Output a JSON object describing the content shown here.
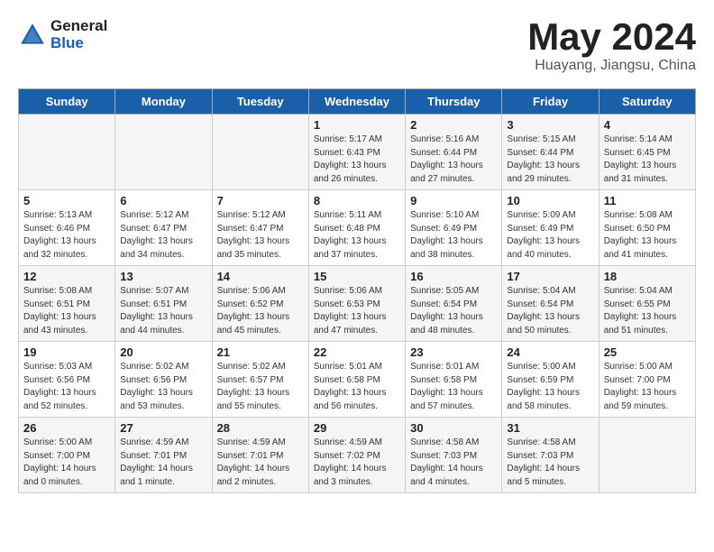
{
  "logo": {
    "general": "General",
    "blue": "Blue"
  },
  "title": "May 2024",
  "location": "Huayang, Jiangsu, China",
  "days_header": [
    "Sunday",
    "Monday",
    "Tuesday",
    "Wednesday",
    "Thursday",
    "Friday",
    "Saturday"
  ],
  "weeks": [
    [
      {
        "day": "",
        "info": ""
      },
      {
        "day": "",
        "info": ""
      },
      {
        "day": "",
        "info": ""
      },
      {
        "day": "1",
        "info": "Sunrise: 5:17 AM\nSunset: 6:43 PM\nDaylight: 13 hours\nand 26 minutes."
      },
      {
        "day": "2",
        "info": "Sunrise: 5:16 AM\nSunset: 6:44 PM\nDaylight: 13 hours\nand 27 minutes."
      },
      {
        "day": "3",
        "info": "Sunrise: 5:15 AM\nSunset: 6:44 PM\nDaylight: 13 hours\nand 29 minutes."
      },
      {
        "day": "4",
        "info": "Sunrise: 5:14 AM\nSunset: 6:45 PM\nDaylight: 13 hours\nand 31 minutes."
      }
    ],
    [
      {
        "day": "5",
        "info": "Sunrise: 5:13 AM\nSunset: 6:46 PM\nDaylight: 13 hours\nand 32 minutes."
      },
      {
        "day": "6",
        "info": "Sunrise: 5:12 AM\nSunset: 6:47 PM\nDaylight: 13 hours\nand 34 minutes."
      },
      {
        "day": "7",
        "info": "Sunrise: 5:12 AM\nSunset: 6:47 PM\nDaylight: 13 hours\nand 35 minutes."
      },
      {
        "day": "8",
        "info": "Sunrise: 5:11 AM\nSunset: 6:48 PM\nDaylight: 13 hours\nand 37 minutes."
      },
      {
        "day": "9",
        "info": "Sunrise: 5:10 AM\nSunset: 6:49 PM\nDaylight: 13 hours\nand 38 minutes."
      },
      {
        "day": "10",
        "info": "Sunrise: 5:09 AM\nSunset: 6:49 PM\nDaylight: 13 hours\nand 40 minutes."
      },
      {
        "day": "11",
        "info": "Sunrise: 5:08 AM\nSunset: 6:50 PM\nDaylight: 13 hours\nand 41 minutes."
      }
    ],
    [
      {
        "day": "12",
        "info": "Sunrise: 5:08 AM\nSunset: 6:51 PM\nDaylight: 13 hours\nand 43 minutes."
      },
      {
        "day": "13",
        "info": "Sunrise: 5:07 AM\nSunset: 6:51 PM\nDaylight: 13 hours\nand 44 minutes."
      },
      {
        "day": "14",
        "info": "Sunrise: 5:06 AM\nSunset: 6:52 PM\nDaylight: 13 hours\nand 45 minutes."
      },
      {
        "day": "15",
        "info": "Sunrise: 5:06 AM\nSunset: 6:53 PM\nDaylight: 13 hours\nand 47 minutes."
      },
      {
        "day": "16",
        "info": "Sunrise: 5:05 AM\nSunset: 6:54 PM\nDaylight: 13 hours\nand 48 minutes."
      },
      {
        "day": "17",
        "info": "Sunrise: 5:04 AM\nSunset: 6:54 PM\nDaylight: 13 hours\nand 50 minutes."
      },
      {
        "day": "18",
        "info": "Sunrise: 5:04 AM\nSunset: 6:55 PM\nDaylight: 13 hours\nand 51 minutes."
      }
    ],
    [
      {
        "day": "19",
        "info": "Sunrise: 5:03 AM\nSunset: 6:56 PM\nDaylight: 13 hours\nand 52 minutes."
      },
      {
        "day": "20",
        "info": "Sunrise: 5:02 AM\nSunset: 6:56 PM\nDaylight: 13 hours\nand 53 minutes."
      },
      {
        "day": "21",
        "info": "Sunrise: 5:02 AM\nSunset: 6:57 PM\nDaylight: 13 hours\nand 55 minutes."
      },
      {
        "day": "22",
        "info": "Sunrise: 5:01 AM\nSunset: 6:58 PM\nDaylight: 13 hours\nand 56 minutes."
      },
      {
        "day": "23",
        "info": "Sunrise: 5:01 AM\nSunset: 6:58 PM\nDaylight: 13 hours\nand 57 minutes."
      },
      {
        "day": "24",
        "info": "Sunrise: 5:00 AM\nSunset: 6:59 PM\nDaylight: 13 hours\nand 58 minutes."
      },
      {
        "day": "25",
        "info": "Sunrise: 5:00 AM\nSunset: 7:00 PM\nDaylight: 13 hours\nand 59 minutes."
      }
    ],
    [
      {
        "day": "26",
        "info": "Sunrise: 5:00 AM\nSunset: 7:00 PM\nDaylight: 14 hours\nand 0 minutes."
      },
      {
        "day": "27",
        "info": "Sunrise: 4:59 AM\nSunset: 7:01 PM\nDaylight: 14 hours\nand 1 minute."
      },
      {
        "day": "28",
        "info": "Sunrise: 4:59 AM\nSunset: 7:01 PM\nDaylight: 14 hours\nand 2 minutes."
      },
      {
        "day": "29",
        "info": "Sunrise: 4:59 AM\nSunset: 7:02 PM\nDaylight: 14 hours\nand 3 minutes."
      },
      {
        "day": "30",
        "info": "Sunrise: 4:58 AM\nSunset: 7:03 PM\nDaylight: 14 hours\nand 4 minutes."
      },
      {
        "day": "31",
        "info": "Sunrise: 4:58 AM\nSunset: 7:03 PM\nDaylight: 14 hours\nand 5 minutes."
      },
      {
        "day": "",
        "info": ""
      }
    ]
  ]
}
